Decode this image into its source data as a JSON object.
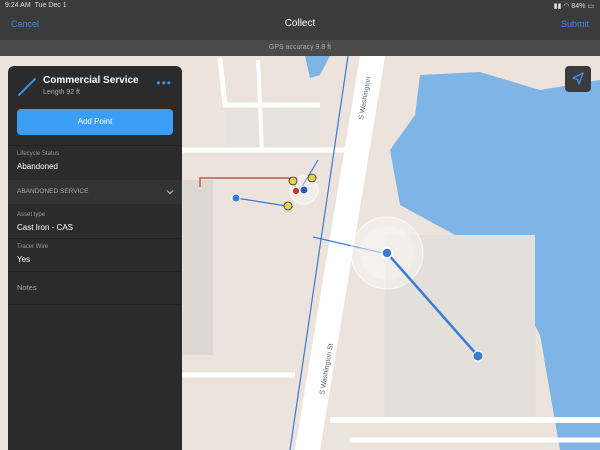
{
  "status": {
    "time": "9:24 AM",
    "date": "Tue Dec 1",
    "battery": "84%"
  },
  "nav": {
    "cancel": "Cancel",
    "title": "Collect",
    "submit": "Submit"
  },
  "gps": {
    "accuracy": "GPS accuracy 9.8 ft"
  },
  "panel": {
    "title": "Commercial Service",
    "subtitle": "Length 92 ft",
    "add_point": "Add Point",
    "fields": {
      "lifecycle_label": "Lifecycle Status",
      "lifecycle_value": "Abandoned",
      "section": "ABANDONED SERVICE",
      "asset_label": "Asset type",
      "asset_value": "Cast Iron - CAS",
      "tracer_label": "Tracer Wire",
      "tracer_value": "Yes",
      "notes_placeholder": "Notes"
    }
  },
  "map": {
    "street_upper": "S Washington",
    "street_lower": "S Washington St",
    "colors": {
      "land": "#ece4dc",
      "water": "#7fb5e6",
      "line": "#3a7bd5",
      "abandoned": "#c0392b"
    }
  }
}
